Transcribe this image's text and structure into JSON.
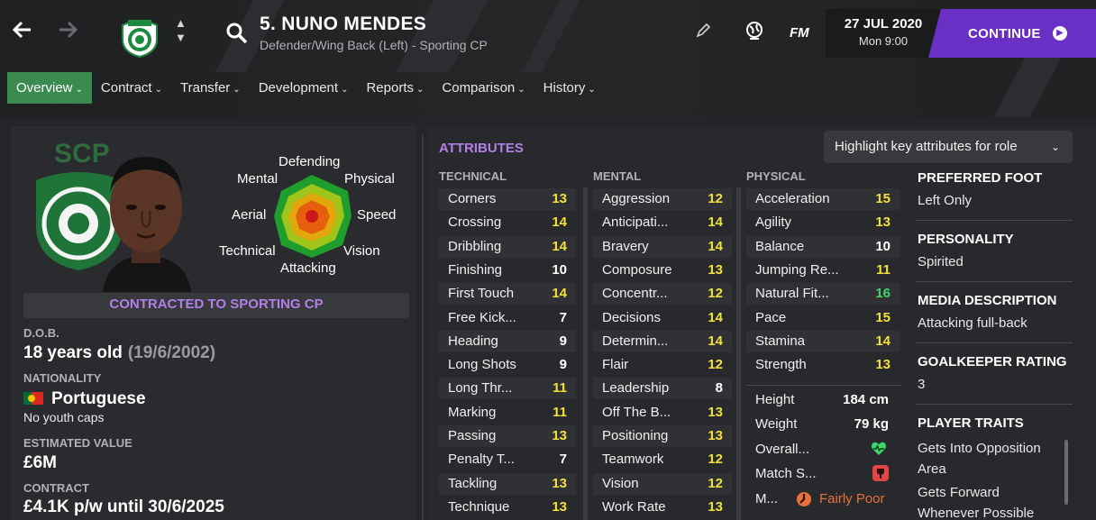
{
  "nav": {
    "back_icon": "back-arrow-icon",
    "forward_icon": "forward-arrow-icon"
  },
  "player": {
    "title": "5. NUNO MENDES",
    "role": "Defender/Wing Back (Left) - Sporting CP"
  },
  "top_icons": {
    "edit": "pencil-icon",
    "world": "globe-icon",
    "fm_label": "FM"
  },
  "date": {
    "day": "27 JUL 2020",
    "time": "Mon 9:00"
  },
  "continue_label": "CONTINUE",
  "tabs": [
    "Overview",
    "Contract",
    "Transfer",
    "Development",
    "Reports",
    "Comparison",
    "History"
  ],
  "radar": {
    "labels": {
      "defending": "Defending",
      "mental": "Mental",
      "physical": "Physical",
      "aerial": "Aerial",
      "speed": "Speed",
      "technical": "Technical",
      "vision": "Vision",
      "attacking": "Attacking"
    },
    "colors": {
      "outer": "#1f9e2d",
      "mid": "#9fc41a",
      "inner": "#e1a70c",
      "core": "#e55f0c",
      "center": "#cc1818"
    }
  },
  "contract_banner": "CONTRACTED TO SPORTING CP",
  "info": {
    "dob_label": "D.O.B.",
    "dob_age": "18 years old",
    "dob_date": "(19/6/2002)",
    "nat_label": "NATIONALITY",
    "nationality": "Portuguese",
    "youth_caps": "No youth caps",
    "value_label": "ESTIMATED VALUE",
    "value": "£6M",
    "contract_label": "CONTRACT",
    "contract": "£4.1K p/w until 30/6/2025"
  },
  "attributes": {
    "title": "ATTRIBUTES",
    "highlight_label": "Highlight key attributes for role",
    "headers": {
      "technical": "TECHNICAL",
      "mental": "MENTAL",
      "physical": "PHYSICAL"
    },
    "technical": [
      {
        "name": "Corners",
        "value": "13"
      },
      {
        "name": "Crossing",
        "value": "14"
      },
      {
        "name": "Dribbling",
        "value": "14"
      },
      {
        "name": "Finishing",
        "value": "10"
      },
      {
        "name": "First Touch",
        "value": "14"
      },
      {
        "name": "Free Kick...",
        "value": "7"
      },
      {
        "name": "Heading",
        "value": "9"
      },
      {
        "name": "Long Shots",
        "value": "9"
      },
      {
        "name": "Long Thr...",
        "value": "11"
      },
      {
        "name": "Marking",
        "value": "11"
      },
      {
        "name": "Passing",
        "value": "13"
      },
      {
        "name": "Penalty T...",
        "value": "7"
      },
      {
        "name": "Tackling",
        "value": "13"
      },
      {
        "name": "Technique",
        "value": "13"
      }
    ],
    "mental": [
      {
        "name": "Aggression",
        "value": "12"
      },
      {
        "name": "Anticipati...",
        "value": "14"
      },
      {
        "name": "Bravery",
        "value": "14"
      },
      {
        "name": "Composure",
        "value": "13"
      },
      {
        "name": "Concentr...",
        "value": "12"
      },
      {
        "name": "Decisions",
        "value": "14"
      },
      {
        "name": "Determin...",
        "value": "14"
      },
      {
        "name": "Flair",
        "value": "12"
      },
      {
        "name": "Leadership",
        "value": "8"
      },
      {
        "name": "Off The B...",
        "value": "13"
      },
      {
        "name": "Positioning",
        "value": "13"
      },
      {
        "name": "Teamwork",
        "value": "12"
      },
      {
        "name": "Vision",
        "value": "12"
      },
      {
        "name": "Work Rate",
        "value": "13"
      }
    ],
    "physical": [
      {
        "name": "Acceleration",
        "value": "15"
      },
      {
        "name": "Agility",
        "value": "13"
      },
      {
        "name": "Balance",
        "value": "10"
      },
      {
        "name": "Jumping Re...",
        "value": "11"
      },
      {
        "name": "Natural Fit...",
        "value": "16"
      },
      {
        "name": "Pace",
        "value": "15"
      },
      {
        "name": "Stamina",
        "value": "14"
      },
      {
        "name": "Strength",
        "value": "13"
      }
    ],
    "value_colors": {
      "low": "#ffffff",
      "mid": "#f2e13b",
      "high": "#3fd56a"
    }
  },
  "physical_info": {
    "height_label": "Height",
    "height": "184 cm",
    "weight_label": "Weight",
    "weight": "79 kg",
    "overall_label": "Overall...",
    "overall_icon": "heart-icon",
    "match_label": "Match S...",
    "match_icon": "match-sharpness-icon",
    "morale_label": "M...",
    "morale_icon": "morale-icon",
    "morale": "Fairly Poor"
  },
  "right": {
    "foot_label": "PREFERRED FOOT",
    "foot": "Left Only",
    "personality_label": "PERSONALITY",
    "personality": "Spirited",
    "media_label": "MEDIA DESCRIPTION",
    "media": "Attacking full-back",
    "gk_label": "GOALKEEPER RATING",
    "gk": "3",
    "traits_label": "PLAYER TRAITS",
    "traits": [
      "Gets Into Opposition",
      "Area",
      "Gets Forward",
      "Whenever Possible"
    ]
  }
}
